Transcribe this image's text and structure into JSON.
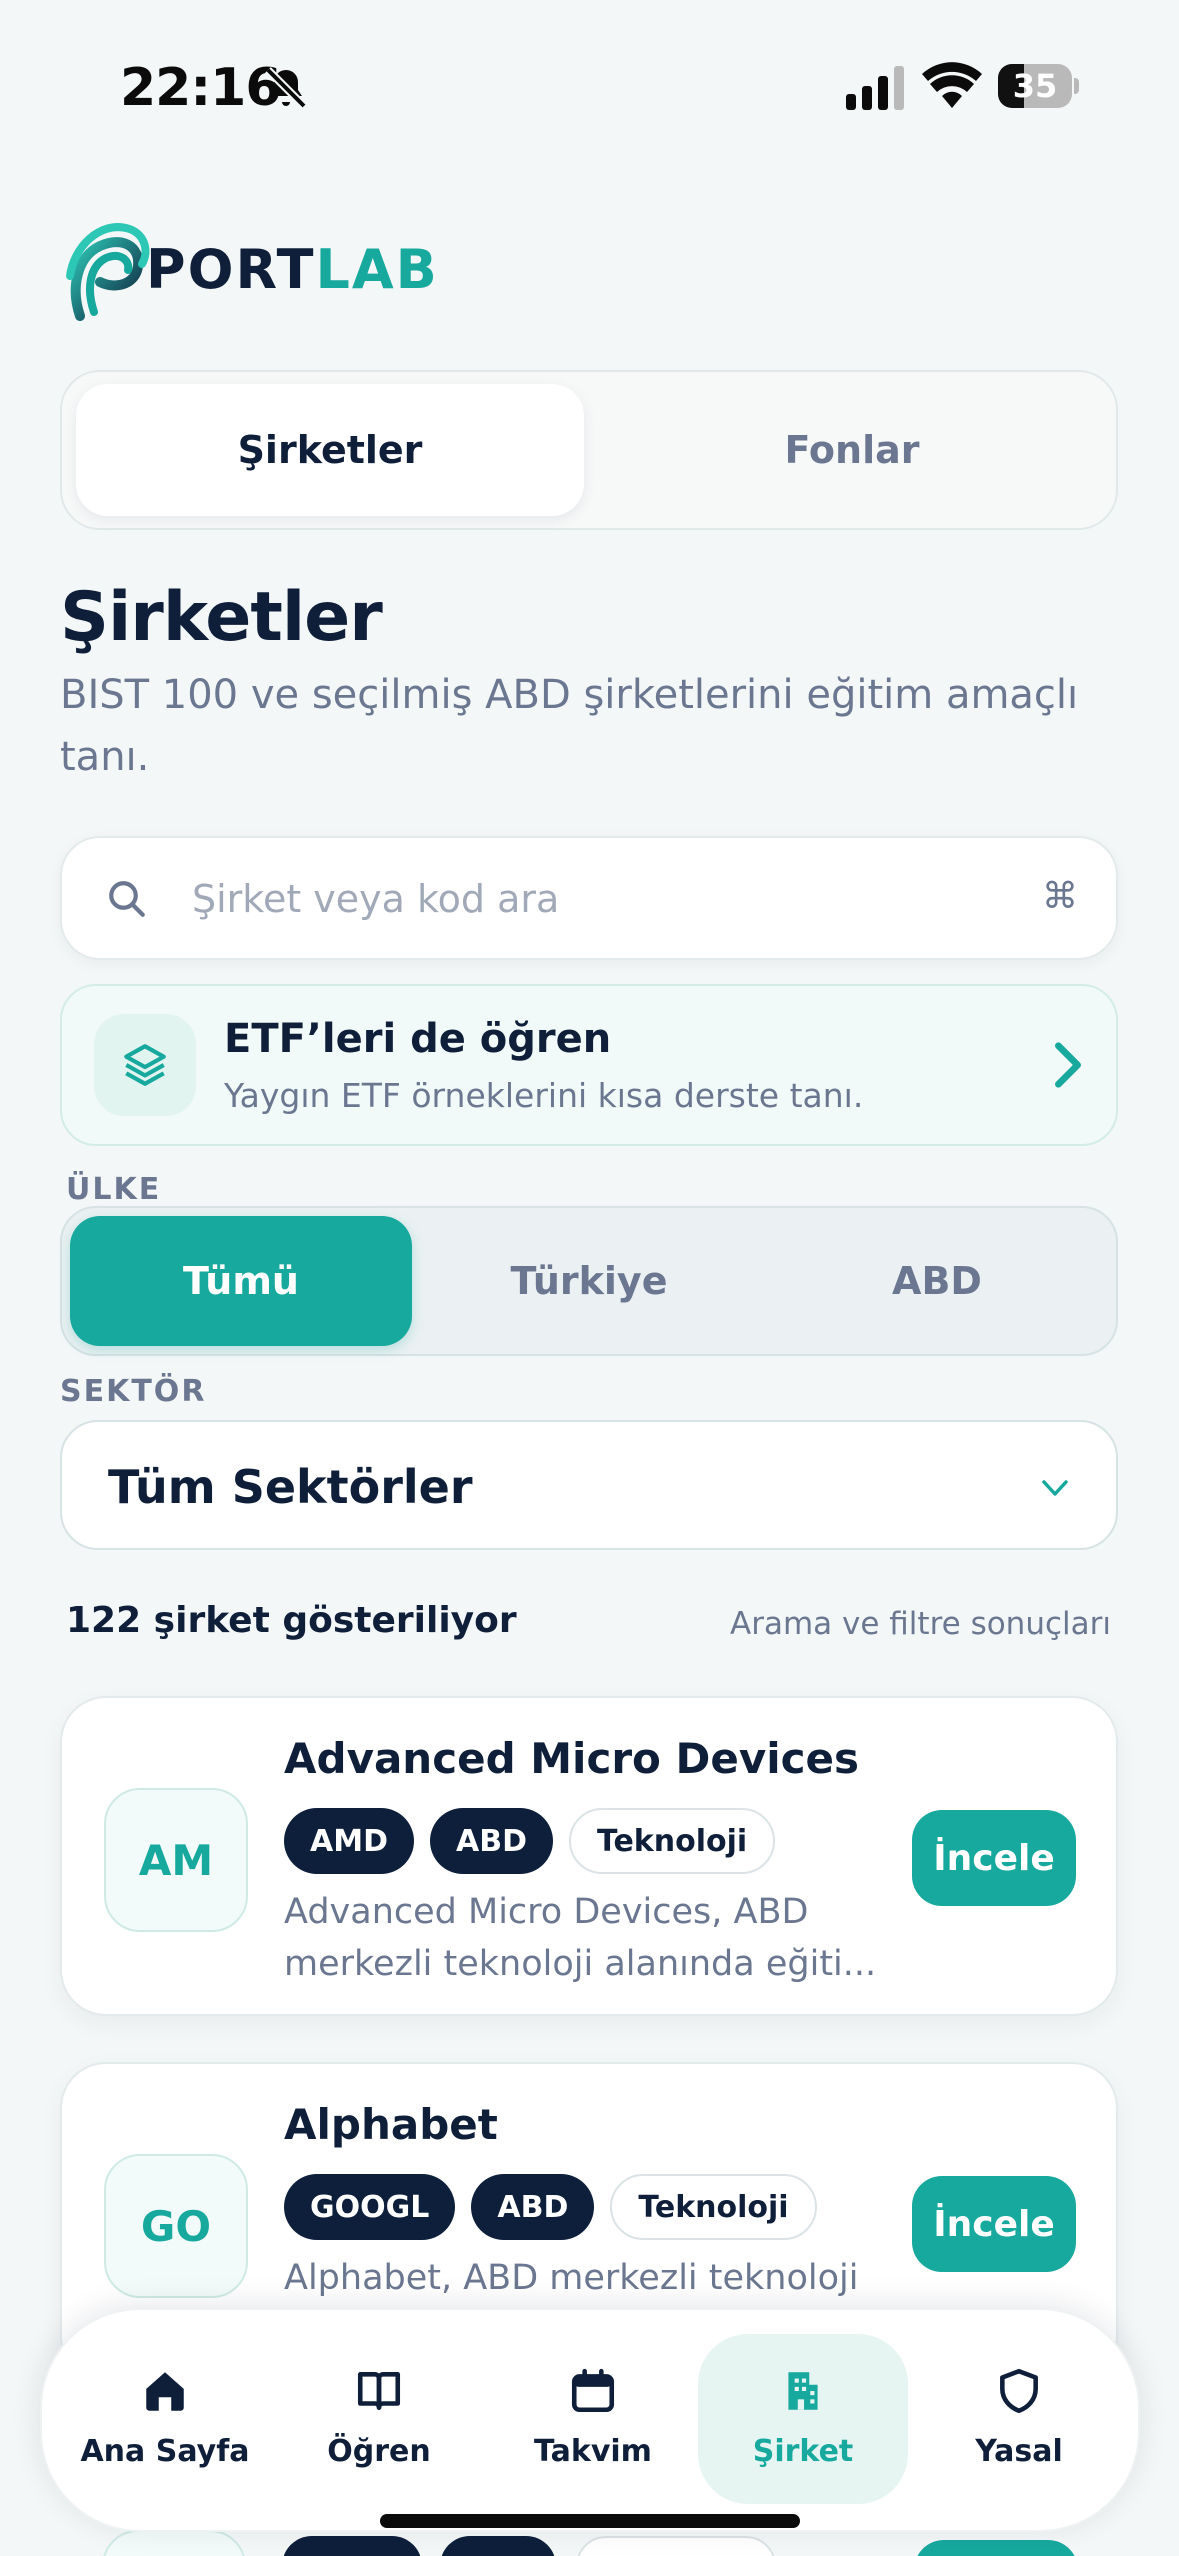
{
  "status_bar": {
    "time": "22:16",
    "battery_level": "35",
    "icons": [
      "bell-slash-icon",
      "cellular-signal-icon",
      "wifi-icon",
      "battery-icon"
    ]
  },
  "brand": {
    "name_part1": "PORT",
    "name_part2": "LAB",
    "accent_color": "#17a89e",
    "dark_color": "#0f1f3a"
  },
  "tabs": [
    {
      "label": "Şirketler",
      "active": true
    },
    {
      "label": "Fonlar",
      "active": false
    }
  ],
  "page": {
    "title": "Şirketler",
    "description": "BIST 100 ve seçilmiş ABD şirketlerini eğitim amaçlı tanı."
  },
  "search": {
    "placeholder": "Şirket veya kod ara",
    "value": "",
    "shortcut_icon": "⌘"
  },
  "etf_banner": {
    "icon": "layers-icon",
    "title": "ETF’leri de öğren",
    "subtitle": "Yaygın ETF örneklerini kısa derste tanı."
  },
  "country_filter": {
    "label": "ÜLKE",
    "options": [
      {
        "label": "Tümü",
        "active": true
      },
      {
        "label": "Türkiye",
        "active": false
      },
      {
        "label": "ABD",
        "active": false
      }
    ]
  },
  "sector_filter": {
    "label": "SEKTÖR",
    "selected": "Tüm Sektörler"
  },
  "results": {
    "count_text": "122 şirket gösteriliyor",
    "note": "Arama ve filtre sonuçları"
  },
  "companies": [
    {
      "initials": "AM",
      "name": "Advanced Micro Devices",
      "ticker": "AMD",
      "country": "ABD",
      "sector": "Teknoloji",
      "description": "Advanced Micro Devices, ABD merkezli teknoloji alanında eğiti...",
      "action": "İncele"
    },
    {
      "initials": "GO",
      "name": "Alphabet",
      "ticker": "GOOGL",
      "country": "ABD",
      "sector": "Teknoloji",
      "description": "Alphabet, ABD merkezli teknoloji",
      "action": "İncele"
    }
  ],
  "bottom_nav": [
    {
      "label": "Ana Sayfa",
      "icon": "home-icon",
      "active": false
    },
    {
      "label": "Öğren",
      "icon": "book-icon",
      "active": false
    },
    {
      "label": "Takvim",
      "icon": "calendar-icon",
      "active": false
    },
    {
      "label": "Şirket",
      "icon": "building-icon",
      "active": true
    },
    {
      "label": "Yasal",
      "icon": "shield-icon",
      "active": false
    }
  ]
}
